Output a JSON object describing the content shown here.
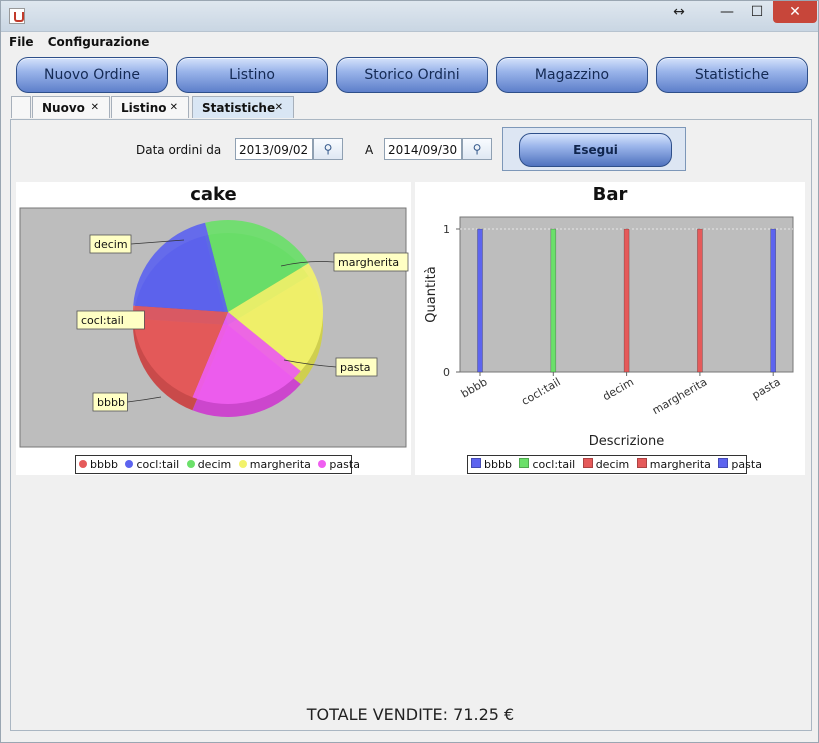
{
  "menu": {
    "file": "File",
    "config": "Configurazione"
  },
  "nav": [
    {
      "label": "Nuovo Ordine"
    },
    {
      "label": "Listino"
    },
    {
      "label": "Storico Ordini"
    },
    {
      "label": "Magazzino"
    },
    {
      "label": "Statistiche"
    }
  ],
  "tabs": [
    {
      "label": "Nuovo"
    },
    {
      "label": "Listino"
    },
    {
      "label": "Statistiche"
    }
  ],
  "filters": {
    "from_label": "Data ordini da",
    "from_value": "2013/09/02",
    "to_label": "A",
    "to_value": "2014/09/30",
    "execute": "Esegui"
  },
  "colors": {
    "bbbb": "#e55a5a",
    "cocktail": "#5d64ef",
    "decim": "#6be06a",
    "margherita": "#f2f26b",
    "pasta": "#ef5ef0",
    "bg": "#bdbdbd"
  },
  "chart_data": [
    {
      "type": "pie",
      "title": "cake",
      "labels": [
        "bbbb",
        "cocl:tail",
        "decim",
        "margherita",
        "pasta"
      ],
      "values": [
        1,
        1,
        1,
        1,
        1
      ],
      "legend": [
        "bbbb",
        "cocl:tail",
        "decim",
        "margherita",
        "pasta"
      ]
    },
    {
      "type": "bar",
      "title": "Bar",
      "xlabel": "Descrizione",
      "ylabel": "Quantità",
      "categories": [
        "bbbb",
        "cocl:tail",
        "decim",
        "margherita",
        "pasta"
      ],
      "values": [
        1,
        1,
        1,
        1,
        1
      ],
      "ylim": [
        0,
        1
      ],
      "yticks": [
        "0",
        "1"
      ],
      "legend": [
        "bbbb",
        "cocl:tail",
        "decim",
        "margherita",
        "pasta"
      ]
    }
  ],
  "total": "TOTALE VENDITE: 71.25 €"
}
